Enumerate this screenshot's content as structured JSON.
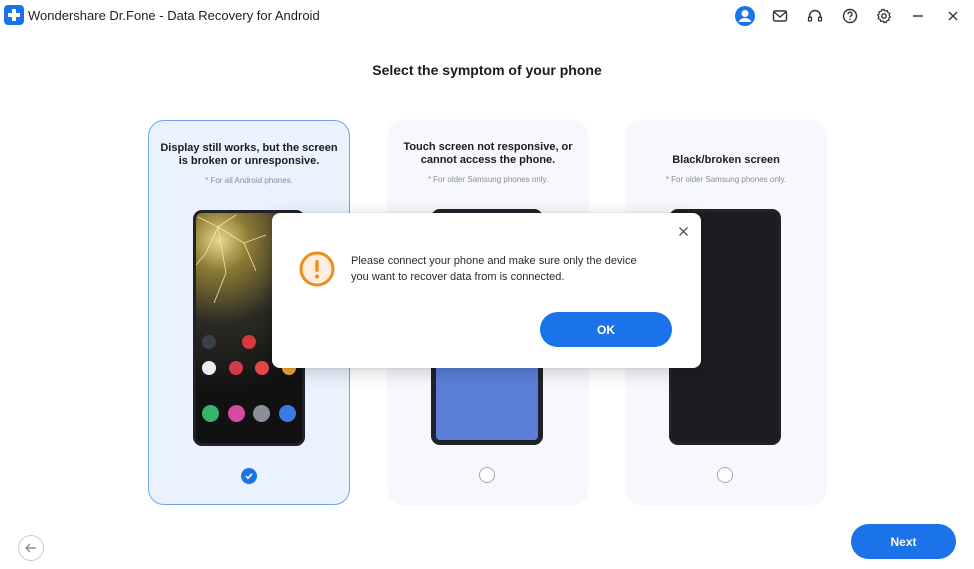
{
  "window": {
    "title": "Wondershare Dr.Fone - Data Recovery for Android",
    "icons": [
      "account-icon",
      "mail-icon",
      "headset-icon",
      "help-icon",
      "settings-icon",
      "minimize-icon",
      "close-icon"
    ]
  },
  "page": {
    "heading": "Select the symptom of your phone"
  },
  "options": [
    {
      "title": "Display still works, but the screen is broken or unresponsive.",
      "note": "* For all Android phones.",
      "selected": true
    },
    {
      "title": "Touch screen not responsive, or cannot access the phone.",
      "note": "* For older Samsung phones only.",
      "selected": false
    },
    {
      "title": "Black/broken screen",
      "note": "* For older Samsung phones only.",
      "selected": false
    }
  ],
  "dialog": {
    "message": "Please connect your phone and make sure only the device you want to recover data from is connected.",
    "ok_label": "OK",
    "icon": "warning-icon"
  },
  "footer": {
    "back_icon": "back-arrow-icon",
    "next_label": "Next"
  },
  "colors": {
    "accent": "#1a73e8",
    "warning": "#f08c1c",
    "card_bg": "#f6f8fd",
    "selected_border": "#6ea4ef"
  }
}
